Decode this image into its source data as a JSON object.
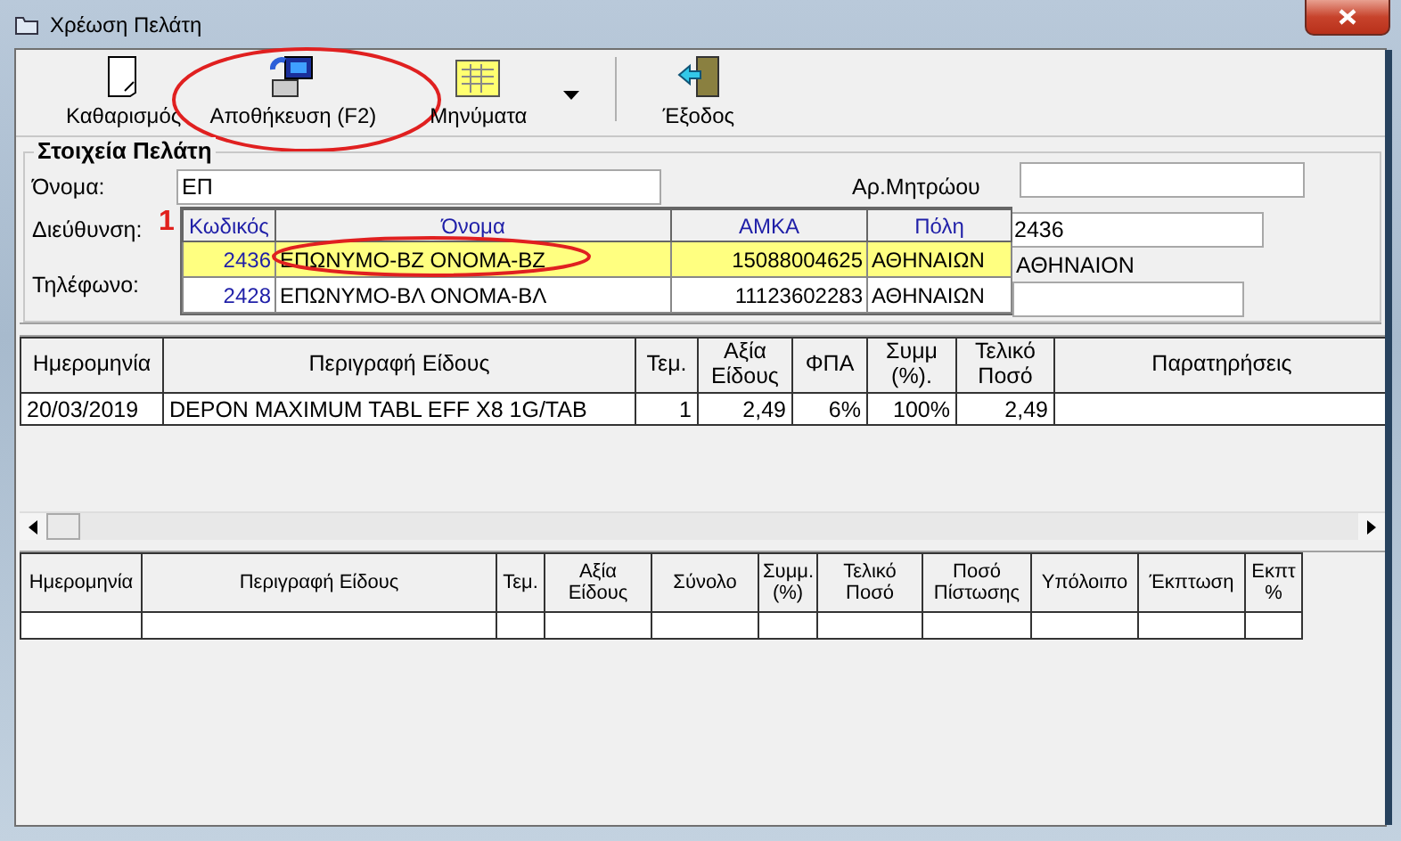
{
  "window": {
    "title": "Χρέωση Πελάτη"
  },
  "toolbar": {
    "buttons": [
      {
        "kind": "page",
        "label": "Καθαρισμός",
        "circled": false
      },
      {
        "kind": "save",
        "label": "Αποθήκευση (F2)",
        "circled": true
      },
      {
        "kind": "messages",
        "label": "Μηνύματα",
        "circled": false,
        "dropdown": true
      },
      {
        "kind": "exit",
        "label": "Έξοδος",
        "circled": false
      }
    ]
  },
  "customer": {
    "title": "Στοιχεία Πελάτη",
    "name_label": "Όνομα:",
    "name_value": "ΕΠ",
    "registry_label": "Αρ.Μητρώου",
    "address_label": "Διεύθυνση:",
    "code_value": "2436",
    "phone_label": "Τηλέφωνο:",
    "city_text": "ΑΘΗΝΑΙΟΝ",
    "annotation": "1"
  },
  "lookup": {
    "columns": [
      "Κωδικός",
      "Όνομα",
      "ΑΜΚΑ",
      "Πόλη"
    ],
    "rows": [
      {
        "selected": true,
        "circled": true,
        "cells": [
          "2436",
          "ΕΠΩΝΥΜΟ-ΒΖ ΟΝΟΜΑ-ΒΖ",
          "15088004625",
          "ΑΘΗΝΑΙΩΝ"
        ]
      },
      {
        "selected": false,
        "circled": false,
        "cells": [
          "2428",
          "ΕΠΩΝΥΜΟ-ΒΛ ΟΝΟΜΑ-ΒΛ",
          "11123602283",
          "ΑΘΗΝΑΙΩΝ"
        ]
      }
    ]
  },
  "charges": {
    "columns": [
      "Ημερομηνία",
      "Περιγραφή Είδους",
      "Τεμ.",
      "Αξία Είδους",
      "ΦΠΑ",
      "Συμμ (%).",
      "Τελικό Ποσό",
      "Παρατηρήσεις"
    ],
    "rows": [
      [
        "20/03/2019",
        "DEPON MAXIMUM TABL EFF X8 1G/TAB",
        "1",
        "2,49",
        "6%",
        "100%",
        "2,49",
        ""
      ]
    ]
  },
  "history": {
    "columns": [
      "Ημερομηνία",
      "Περιγραφή Είδους",
      "Τεμ.",
      "Αξία Είδους",
      "Σύνολο",
      "Συμμ. (%)",
      "Τελικό Ποσό",
      "Ποσό Πίστωσης",
      "Υπόλοιπο",
      "Έκπτωση",
      "Εκπτ %"
    ]
  }
}
